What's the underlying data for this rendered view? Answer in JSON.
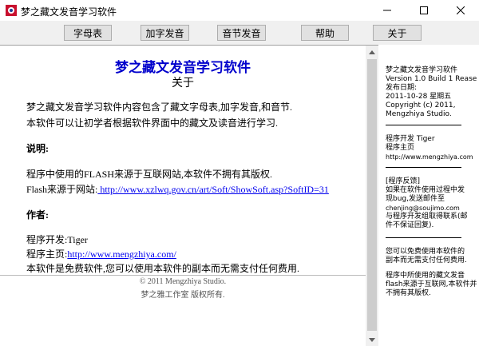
{
  "window": {
    "title": "梦之藏文发音学习软件",
    "minimize_glyph": "—",
    "maximize_glyph": "☐",
    "close_glyph": "✕"
  },
  "toolbar": {
    "buttons": [
      "字母表",
      "加字发音",
      "音节发音",
      "帮助",
      "关于"
    ]
  },
  "content": {
    "title": "梦之藏文发音学习软件",
    "subtitle": "关于",
    "intro": [
      "梦之藏文发音学习软件内容包含了藏文字母表,加字发音,和音节.",
      "本软件可以让初学者根据软件界面中的藏文及读音进行学习."
    ],
    "notes_heading": "说明:",
    "notes_line1": "程序中使用的FLASH来源于互联网站,本软件不拥有其版权.",
    "flash_label": "Flash来源于网站:",
    "flash_url": " http://www.xzlwq.gov.cn/art/Soft/ShowSoft.asp?SoftID=31",
    "author_heading": "作者:",
    "dev_line": "程序开发:Tiger",
    "home_label": "程序主页:",
    "home_url": "http://www.mengzhiya.com/",
    "free_line": "本软件是免费软件,您可以使用本软件的副本而无需支付任何费用.",
    "footer_copyright": "© 2011 Mengzhiya Studio.",
    "footer_studio": "梦之雅工作室 版权所有."
  },
  "sidebar": {
    "app_name": "梦之藏文发音学习软件",
    "version": "Version 1.0 Build 1 Rease 1",
    "release_label": "发布日期:",
    "release_date": "2011-10-28 星期五",
    "copyright": "Copyright (c) 2011,",
    "studio": "Mengzhiya Studio.",
    "dev": "程序开发  Tiger",
    "home_label": "程序主页",
    "home_url": "http://www.mengzhiya.com",
    "feedback_heading": "[程序反馈]",
    "feedback_lines": [
      "如果在软件使用过程中发",
      "现bug,发送邮件至"
    ],
    "email": "chenjing@soujimo.com",
    "contact_lines": [
      "与程序开发组取得联系(邮",
      "件不保证回复)."
    ],
    "free_lines": [
      "您可以免费使用本软件的",
      "副本而无需支付任何费用."
    ],
    "flash_lines": [
      "程序中所使用的藏文发音",
      "flash来源于互联网,本软件并",
      "不拥有其版权."
    ]
  }
}
